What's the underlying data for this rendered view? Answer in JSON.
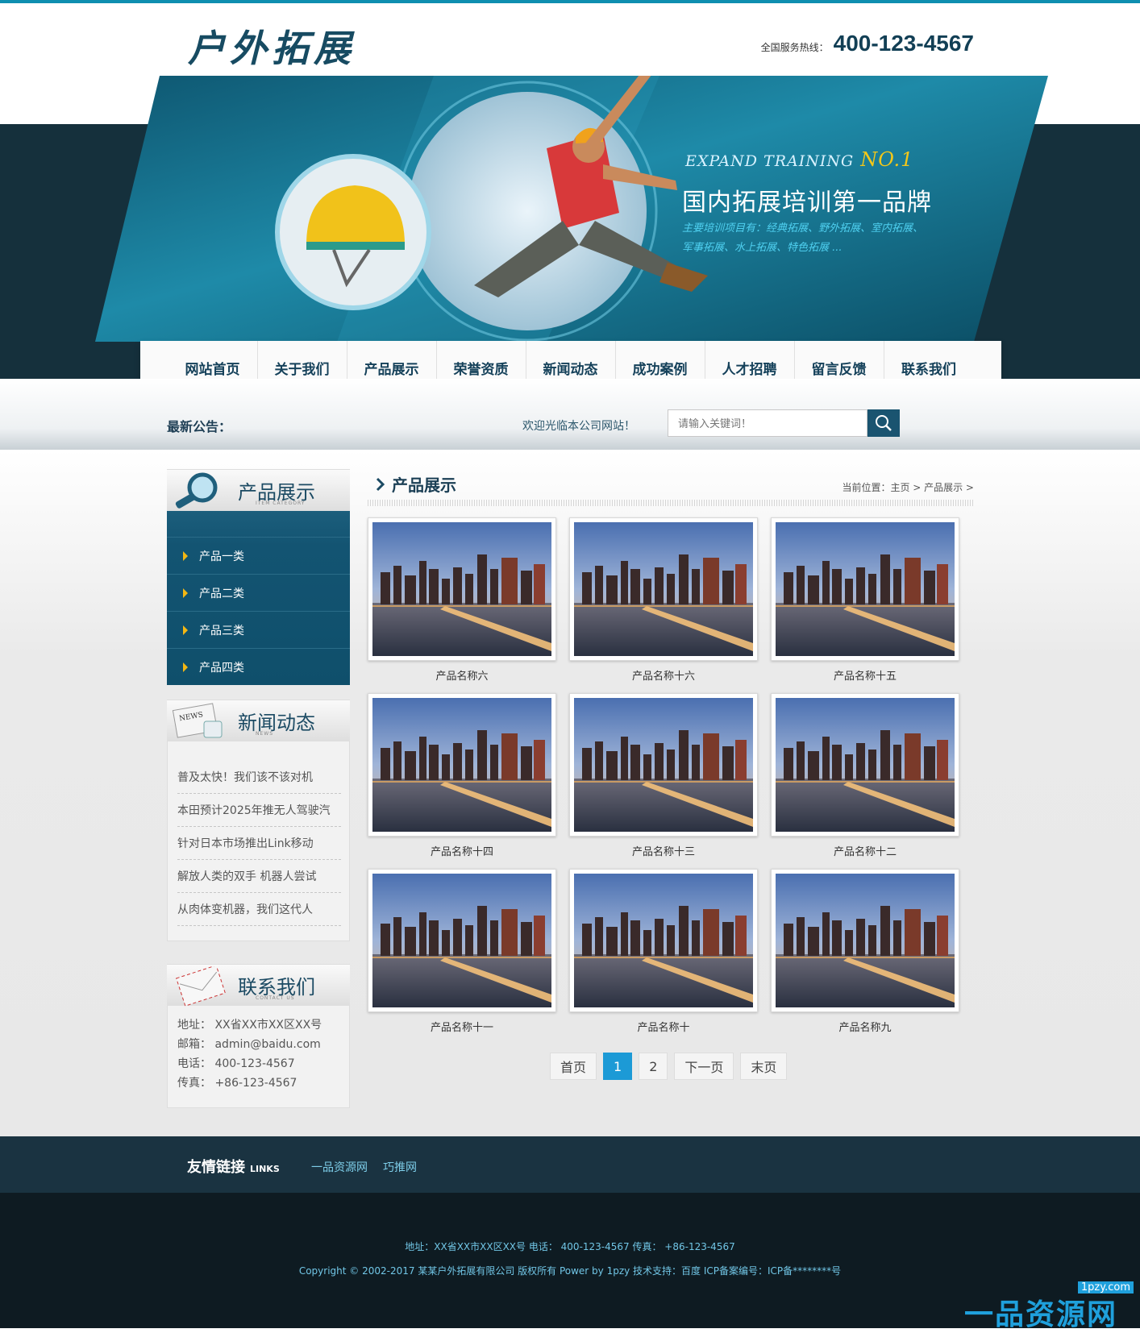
{
  "header": {
    "logo": "户外拓展",
    "hotline_label": "全国服务热线：",
    "hotline_number": "400-123-4567"
  },
  "banner": {
    "en_title": "EXPAND TRAINING",
    "en_no": "NO.1",
    "title": "国内拓展培训第一品牌",
    "desc_line1": "主要培训项目有：经典拓展、野外拓展、室内拓展、",
    "desc_line2": "军事拓展、水上拓展、特色拓展 ..."
  },
  "nav": [
    {
      "label": "网站首页"
    },
    {
      "label": "关于我们"
    },
    {
      "label": "产品展示"
    },
    {
      "label": "荣誉资质"
    },
    {
      "label": "新闻动态"
    },
    {
      "label": "成功案例"
    },
    {
      "label": "人才招聘"
    },
    {
      "label": "留言反馈"
    },
    {
      "label": "联系我们"
    }
  ],
  "notice": {
    "label": "最新公告：",
    "welcome": "欢迎光临本公司网站！",
    "search_placeholder": "请输入关键词！"
  },
  "sidebar": {
    "products": {
      "title": "产品展示",
      "subtitle": "ITEM CATEGORY",
      "items": [
        {
          "label": "产品一类"
        },
        {
          "label": "产品二类"
        },
        {
          "label": "产品三类"
        },
        {
          "label": "产品四类"
        }
      ]
    },
    "news": {
      "title": "新闻动态",
      "subtitle": "NEWS",
      "items": [
        {
          "label": "普及太快！我们该不该对机"
        },
        {
          "label": "本田预计2025年推无人驾驶汽"
        },
        {
          "label": "针对日本市场推出Link移动"
        },
        {
          "label": "解放人类的双手 机器人尝试"
        },
        {
          "label": "从肉体变机器，我们这代人"
        }
      ]
    },
    "contact": {
      "title": "联系我们",
      "subtitle": "CONTACT US",
      "address": "地址： XX省XX市XX区XX号",
      "email": "邮箱： admin@baidu.com",
      "phone": "电话： 400-123-4567",
      "fax": "传真： +86-123-4567"
    }
  },
  "main": {
    "title": "产品展示",
    "breadcrumb": "当前位置：主页 > 产品展示 >",
    "products": [
      {
        "name": "产品名称六"
      },
      {
        "name": "产品名称十六"
      },
      {
        "name": "产品名称十五"
      },
      {
        "name": "产品名称十四"
      },
      {
        "name": "产品名称十三"
      },
      {
        "name": "产品名称十二"
      },
      {
        "name": "产品名称十一"
      },
      {
        "name": "产品名称十"
      },
      {
        "name": "产品名称九"
      }
    ]
  },
  "pagination": {
    "first": "首页",
    "p1": "1",
    "p2": "2",
    "next": "下一页",
    "last": "末页"
  },
  "links": {
    "title": "友情链接",
    "title_en": "LINKS",
    "items": [
      {
        "label": "一品资源网"
      },
      {
        "label": "巧推网"
      }
    ]
  },
  "footer": {
    "line1": "地址：XX省XX市XX区XX号 电话： 400-123-4567 传真： +86-123-4567",
    "line2": "Copyright © 2002-2017 某某户外拓展有限公司 版权所有 Power by 1pzy 技术支持：百度 ICP备案编号：ICP备********号"
  },
  "watermark": {
    "small": "1pzy.com",
    "big": "一品资源网"
  },
  "colors": {
    "accent": "#0f8fb0",
    "dark": "#15303c",
    "nav_text": "#15415a",
    "category_bg": "#135472",
    "active_page": "#1c9ad6"
  }
}
